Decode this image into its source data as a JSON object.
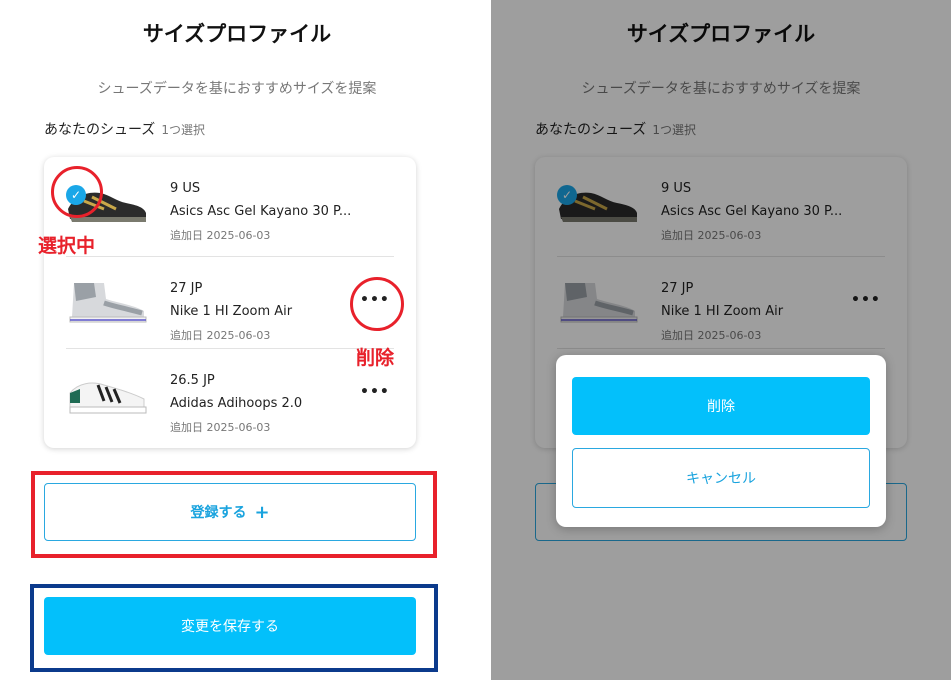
{
  "header": {
    "title": "サイズプロファイル",
    "subtitle": "シューズデータを基におすすめサイズを提案"
  },
  "section": {
    "label": "あなたのシューズ",
    "count": "1つ選択"
  },
  "shoes": [
    {
      "size": "9 US",
      "name": "Asics Asc Gel Kayano 30 P...",
      "date": "追加日 2025-06-03",
      "selected": true
    },
    {
      "size": "27 JP",
      "name": "Nike 1 HI Zoom Air",
      "date": "追加日 2025-06-03",
      "selected": false
    },
    {
      "size": "26.5 JP",
      "name": "Adidas Adihoops 2.0",
      "date": "追加日 2025-06-03",
      "selected": false
    }
  ],
  "more_label": "•••",
  "check_symbol": "✓",
  "buttons": {
    "register": "登録する",
    "register_plus": "+",
    "save": "変更を保存する"
  },
  "annotations": {
    "selected": "選択中",
    "delete": "削除"
  },
  "modal": {
    "delete": "削除",
    "cancel": "キャンセル"
  },
  "colors": {
    "accent": "#03c0fb",
    "outline": "#2aa8e0",
    "annotation_red": "#e8212b",
    "annotation_blue": "#0b3a8c"
  }
}
